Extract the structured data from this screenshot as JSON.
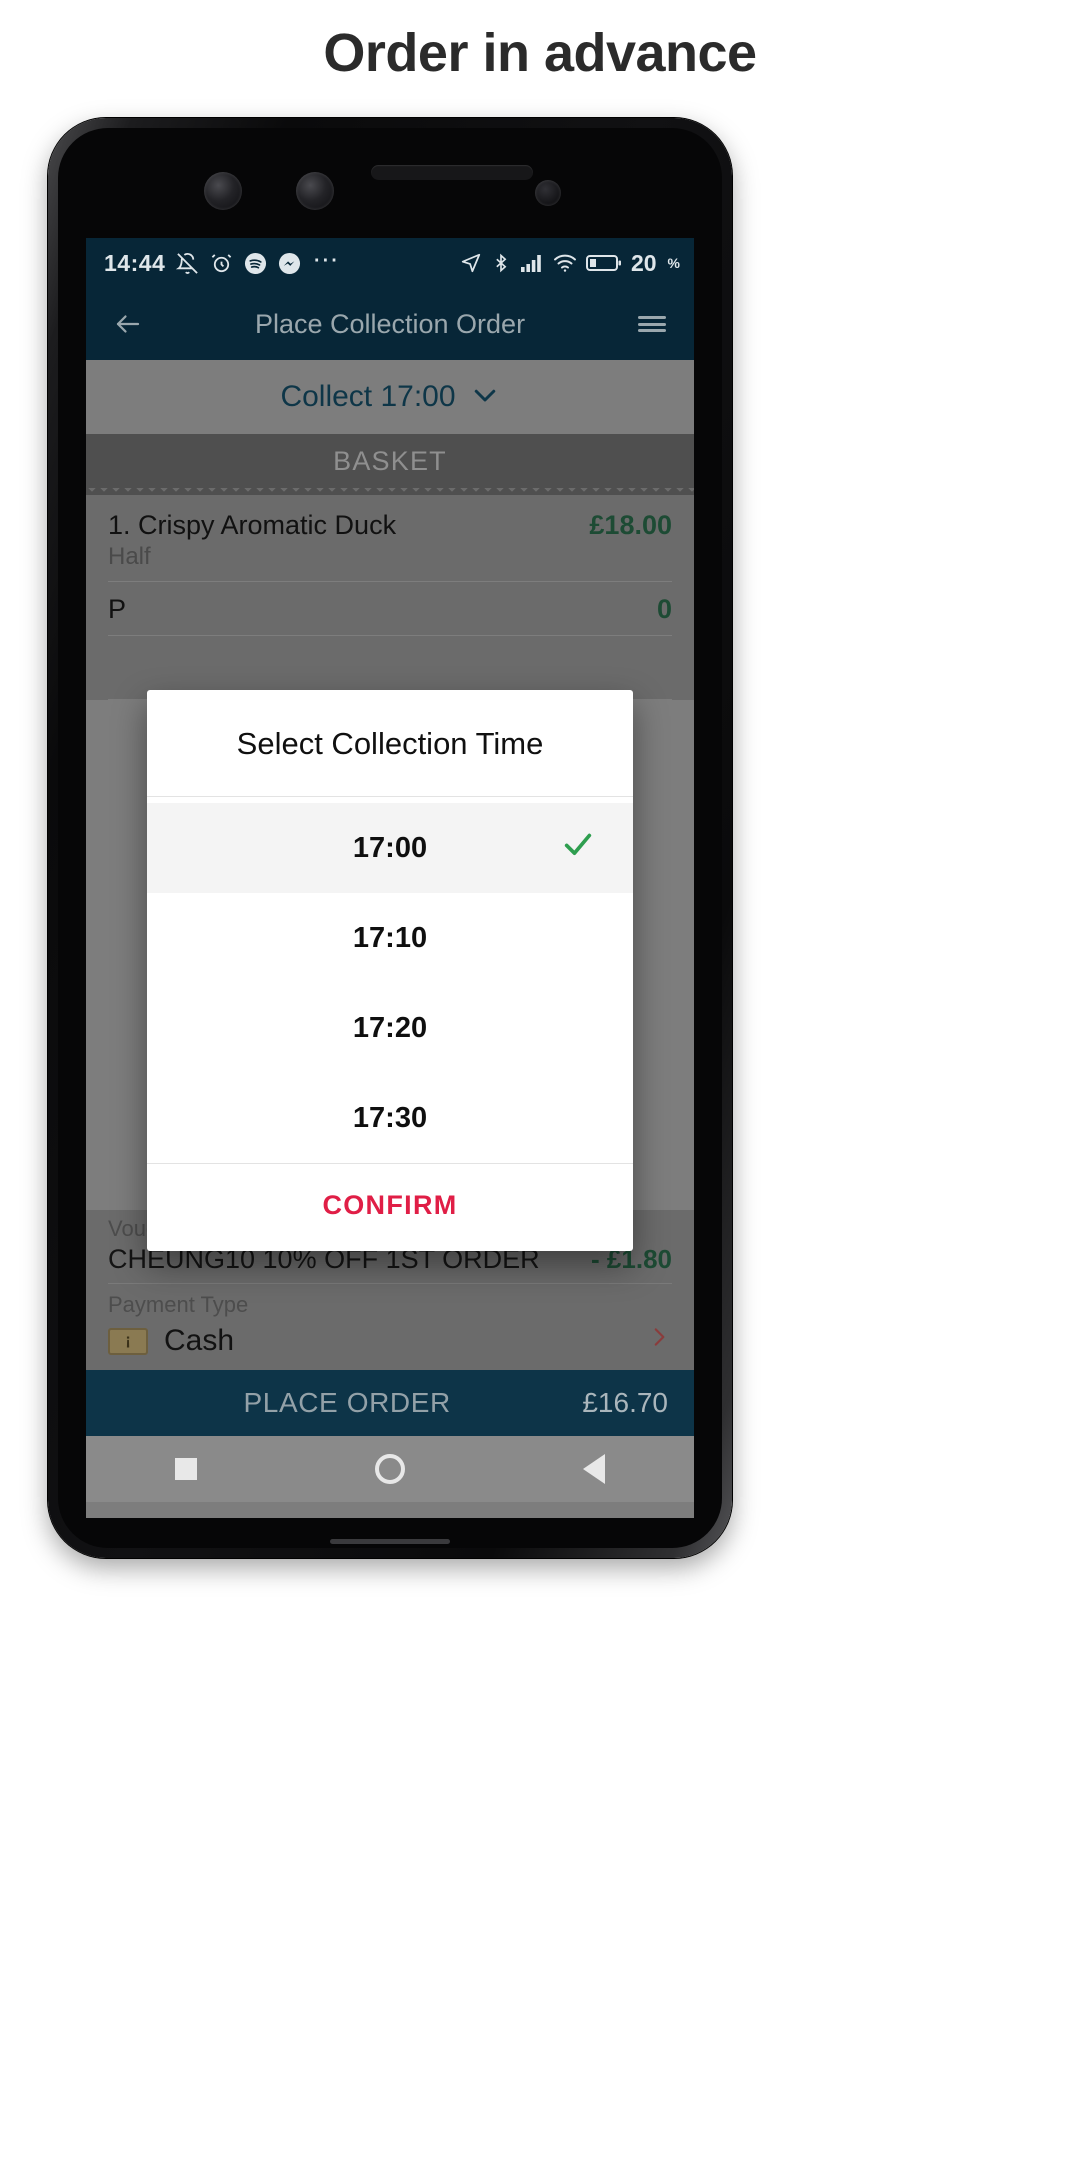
{
  "page": {
    "title": "Order in advance"
  },
  "status_bar": {
    "time": "14:44",
    "overflow_dots": "⋯",
    "battery_percent": "20",
    "percent_sign": "%",
    "icons": [
      "bell-mute-icon",
      "alarm-clock-icon",
      "spotify-icon",
      "messenger-icon",
      "location-arrow-icon",
      "bluetooth-icon",
      "cellular-signal-icon",
      "wifi-icon",
      "battery-icon"
    ]
  },
  "app_bar": {
    "title": "Place Collection Order",
    "back_icon": "arrow-left-icon",
    "menu_icon": "hamburger-menu-icon"
  },
  "collect_bar": {
    "label": "Collect 17:00",
    "chevron": "chevron-down-icon"
  },
  "basket": {
    "header": "BASKET",
    "items": [
      {
        "name": "1. Crispy Aromatic Duck",
        "option": "Half",
        "price": "£18.00"
      },
      {
        "name": "P",
        "option": "",
        "price": "0"
      }
    ]
  },
  "voucher": {
    "label": "Voucher applied",
    "code": "CHEUNG10 10% OFF 1ST ORDER",
    "amount": "- £1.80"
  },
  "payment": {
    "label": "Payment Type",
    "method": "Cash",
    "icon": "banknote-icon",
    "icon_glyph": "¡",
    "chevron": "chevron-right-icon"
  },
  "place_order": {
    "label": "PLACE ORDER",
    "total": "£16.70"
  },
  "nav_bar": {
    "recent": "square-icon",
    "home": "circle-icon",
    "back": "triangle-back-icon"
  },
  "dialog": {
    "title": "Select Collection Time",
    "options": [
      {
        "time": "17:00",
        "selected": true
      },
      {
        "time": "17:10",
        "selected": false
      },
      {
        "time": "17:20",
        "selected": false
      },
      {
        "time": "17:30",
        "selected": false
      }
    ],
    "confirm_label": "CONFIRM",
    "check_icon": "check-icon"
  },
  "colors": {
    "app_bar": "#072637",
    "accent_red": "#e01e46",
    "check_green": "#2e9e4f",
    "price_green": "#1d4b34",
    "place_bar": "#0d3448"
  }
}
